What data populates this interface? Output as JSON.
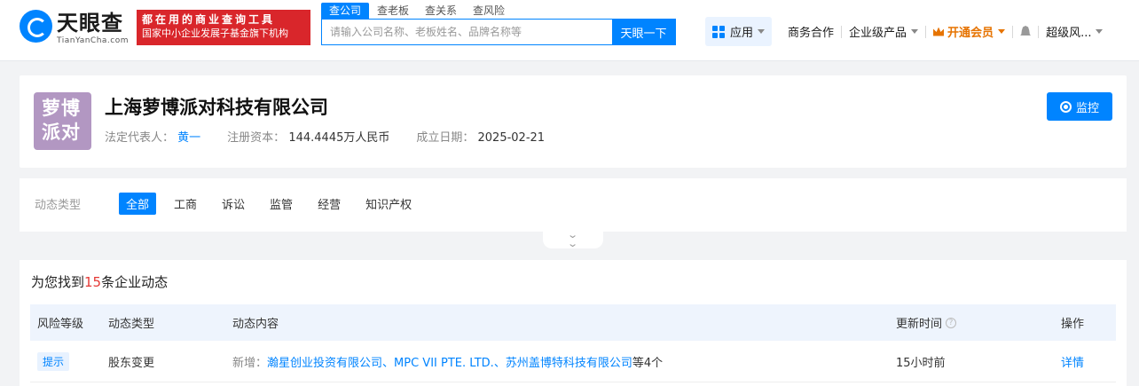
{
  "header": {
    "logo_text": "天眼查",
    "logo_sub": "TianYanCha.com",
    "slogan_line1": "都在用的商业查询工具",
    "slogan_line2": "国家中小企业发展子基金旗下机构",
    "search_tabs": [
      "查公司",
      "查老板",
      "查关系",
      "查风险"
    ],
    "search_placeholder": "请输入公司名称、老板姓名、品牌名称等",
    "search_button": "天眼一下",
    "nav": {
      "apps": "应用",
      "business": "商务合作",
      "enterprise": "企业级产品",
      "vip": "开通会员",
      "user": "超级风..."
    }
  },
  "company": {
    "avatar_line1": "萝博",
    "avatar_line2": "派对",
    "name": "上海萝博派对科技有限公司",
    "legal_rep_label": "法定代表人：",
    "legal_rep": "黄一",
    "capital_label": "注册资本：",
    "capital": "144.4445万人民币",
    "founded_label": "成立日期：",
    "founded": "2025-02-21",
    "monitor_button": "监控"
  },
  "filter": {
    "label": "动态类型",
    "chips": [
      "全部",
      "工商",
      "诉讼",
      "监管",
      "经营",
      "知识产权"
    ]
  },
  "results": {
    "title_prefix": "为您找到",
    "count": "15",
    "title_suffix": "条企业动态",
    "columns": [
      "风险等级",
      "动态类型",
      "动态内容",
      "更新时间",
      "操作"
    ],
    "rows": [
      {
        "risk": "提示",
        "type": "股东变更",
        "content_prefix": "新增：",
        "entities": [
          "瀚星创业投资有限公司",
          "MPC VII PTE. LTD.",
          "苏州盖博特科技有限公司"
        ],
        "separator": "、",
        "content_suffix": "等4个",
        "time": "15小时前",
        "action": "详情"
      }
    ]
  },
  "colors": {
    "primary": "#0084ff",
    "slogan_red": "#d9262b",
    "vip_orange": "#e67300",
    "avatar": "#b297c2",
    "count_red": "#e53935"
  }
}
